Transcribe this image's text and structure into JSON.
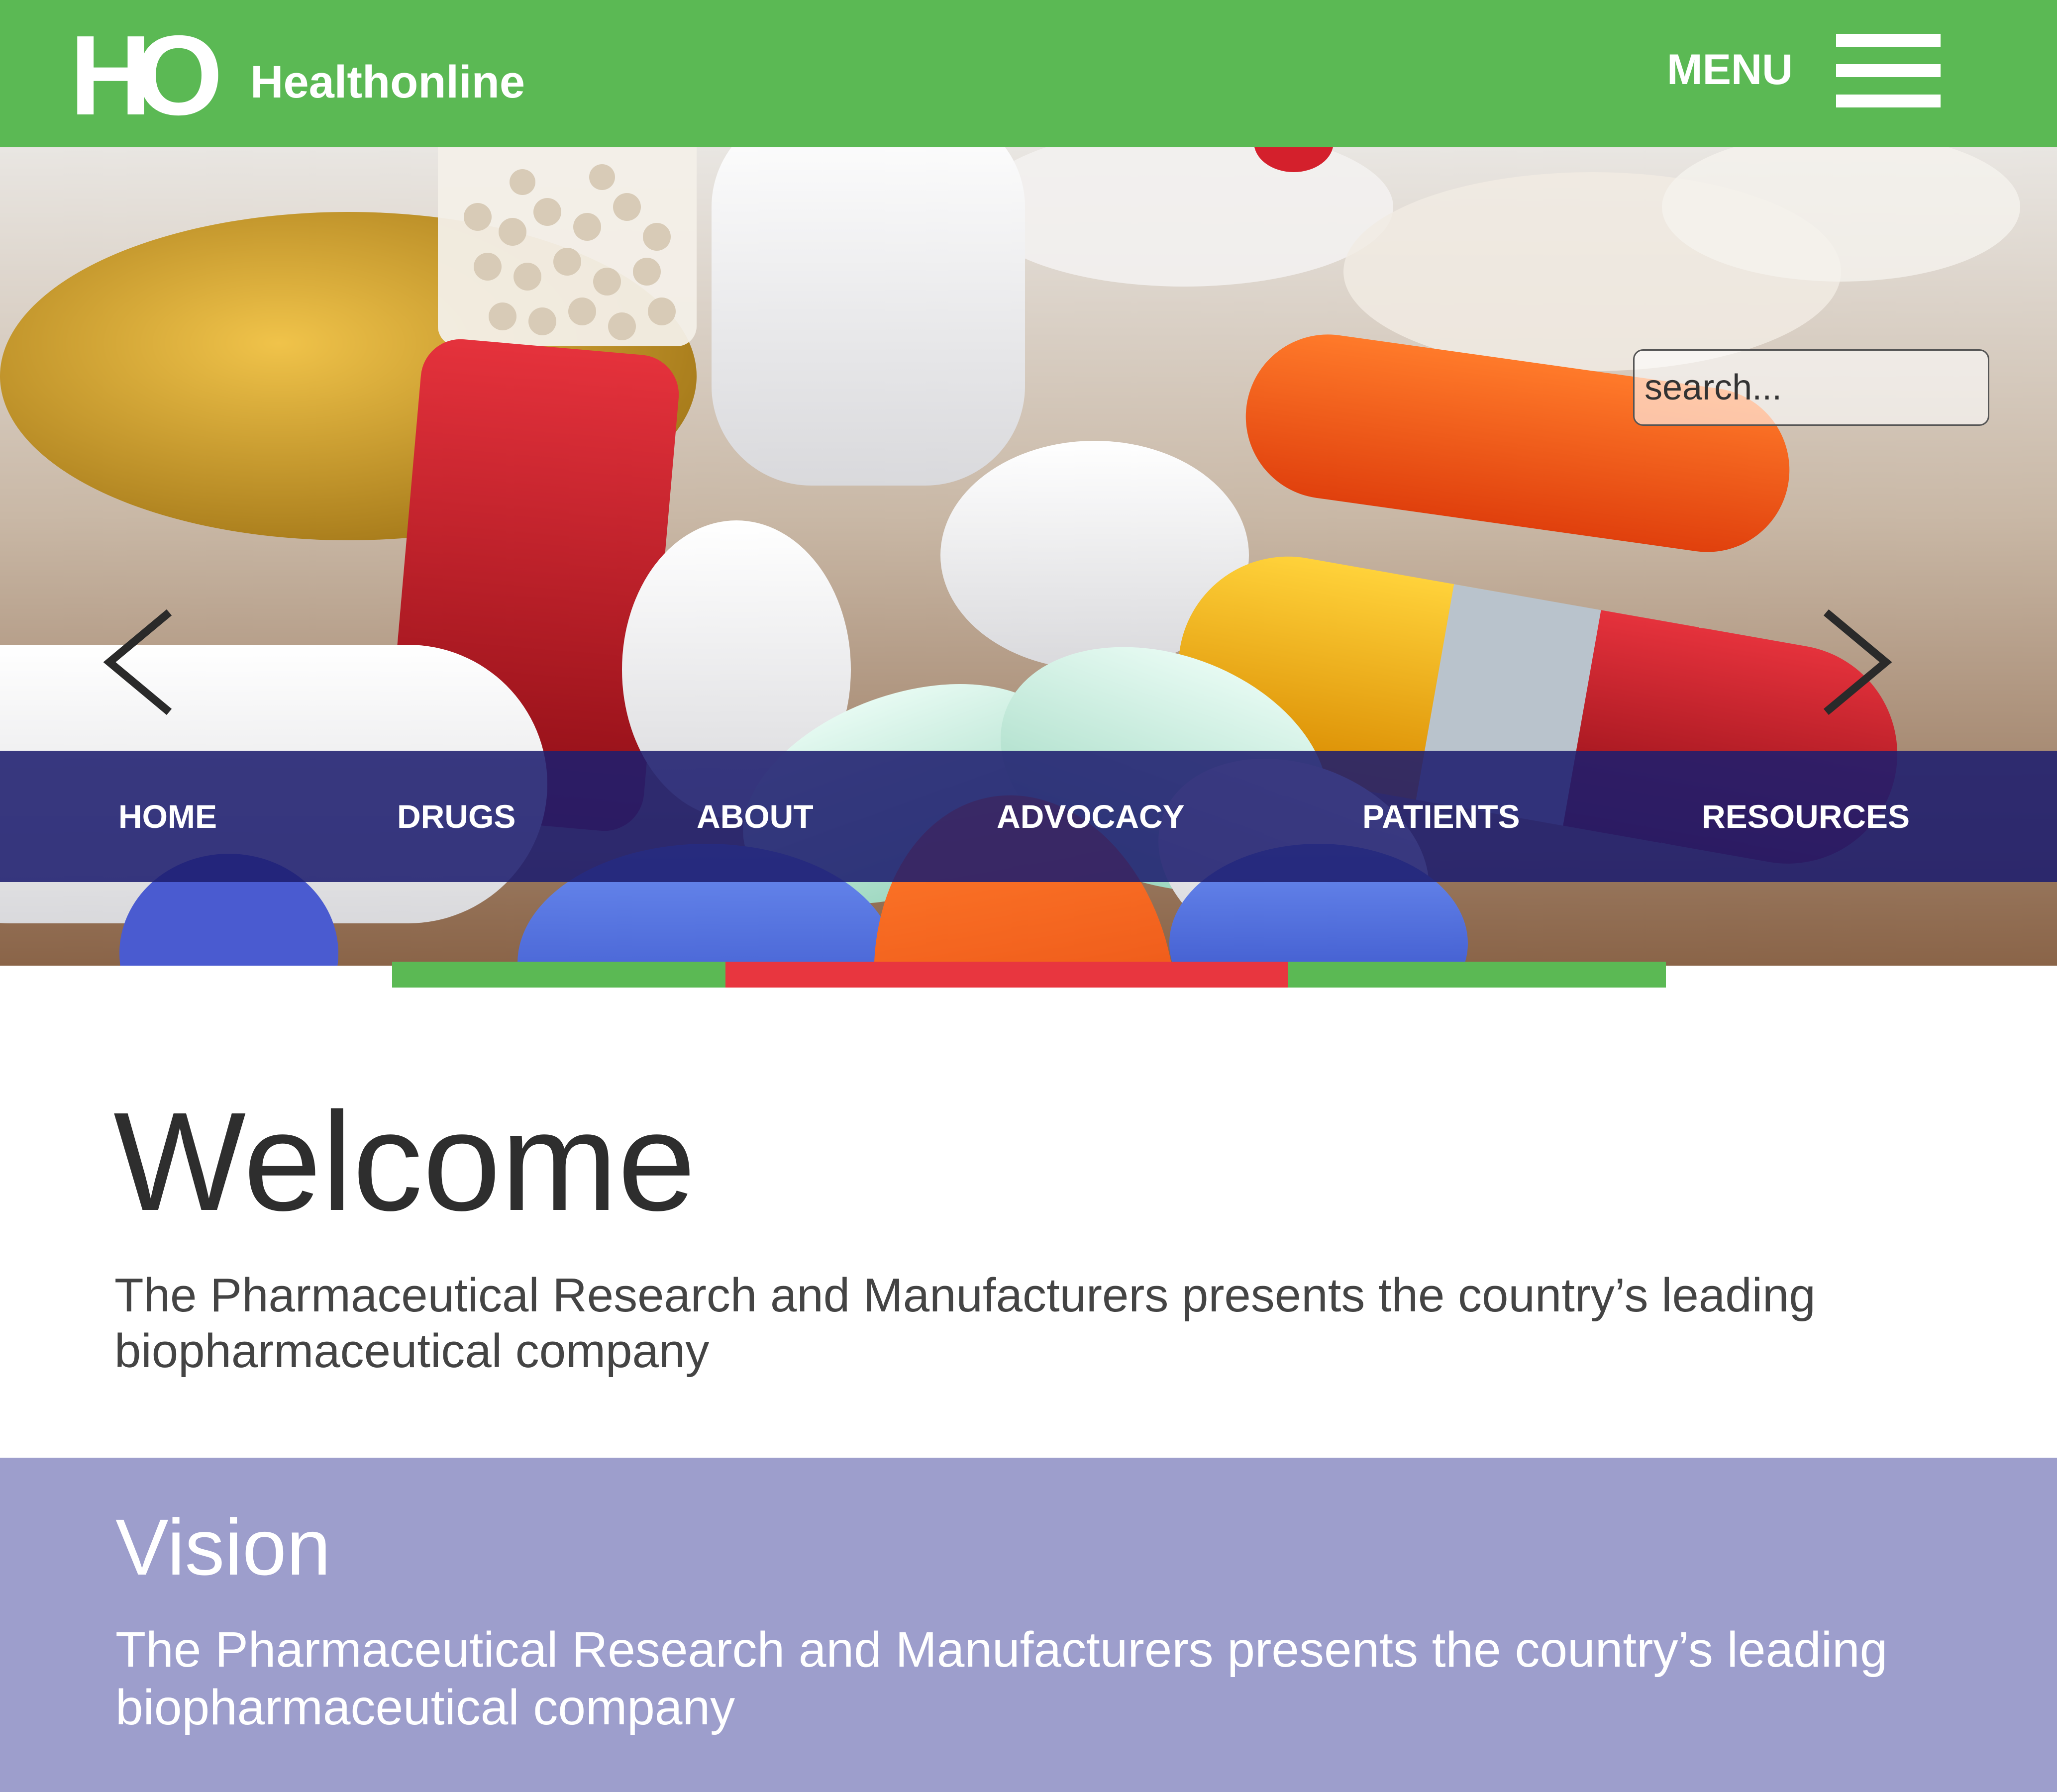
{
  "header": {
    "logo_mark": "HO",
    "brand_name": "Healthonline",
    "menu_label": "MENU"
  },
  "search": {
    "placeholder": "search..."
  },
  "nav": {
    "items": [
      {
        "label": "HOME"
      },
      {
        "label": "DRUGS"
      },
      {
        "label": "ABOUT"
      },
      {
        "label": "ADVOCACY"
      },
      {
        "label": "PATIENTS"
      },
      {
        "label": "RESOURCES"
      }
    ]
  },
  "welcome": {
    "title": "Welcome",
    "text": "The Pharmaceutical Research and Manufacturers presents the country’s leading biopharmaceutical company"
  },
  "vision": {
    "title": "Vision",
    "text": "The Pharmaceutical Research and Manufacturers presents the country’s leading biopharmaceutical company"
  },
  "colors": {
    "header_green": "#5bb954",
    "accent_red": "#e8363f",
    "nav_blue": "#1e1e6e",
    "vision_purple": "#9d9ecc"
  },
  "icons": {
    "menu": "hamburger-icon",
    "prev": "chevron-left-icon",
    "next": "chevron-right-icon"
  }
}
